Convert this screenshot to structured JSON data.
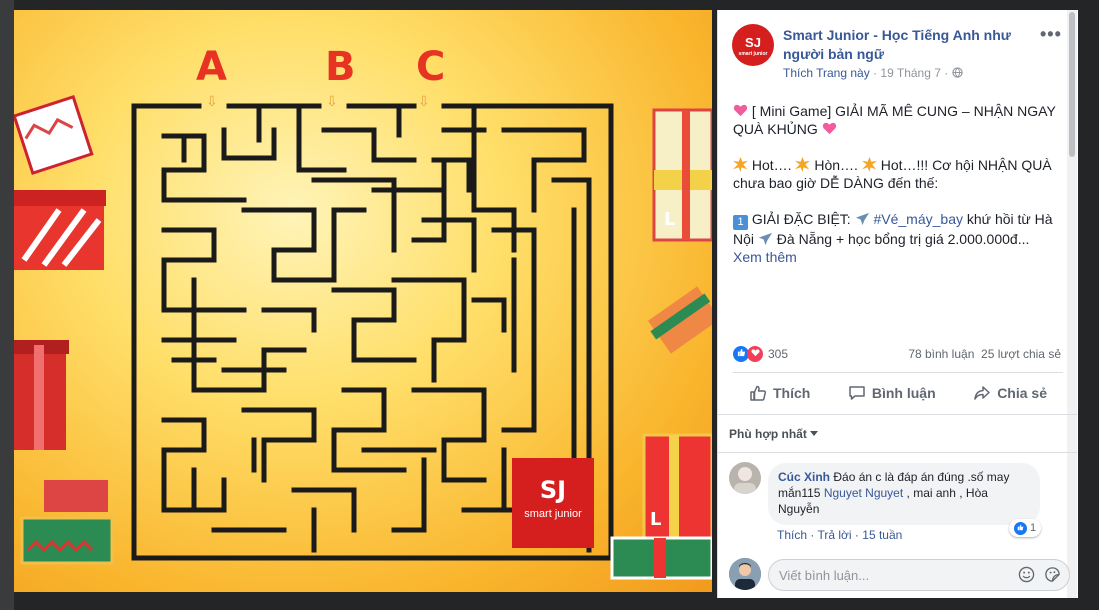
{
  "photo": {
    "maze_letters": [
      "A",
      "B",
      "C"
    ],
    "arrow_glyph": "⇩",
    "logo_mark": "SJ",
    "logo_text": "smart junior",
    "gift_label": "L"
  },
  "post": {
    "page_name": "Smart Junior - Học Tiếng Anh như người bản ngữ",
    "like_page": "Thích Trang này",
    "separator": "·",
    "date": "19 Tháng 7",
    "more": "•••",
    "paragraph1": "[ Mini Game] GIẢI MÃ MÊ CUNG – NHẬN NGAY QUÀ KHỦNG",
    "paragraph2_a": "Hot…. ",
    "paragraph2_b": "Hòn…. ",
    "paragraph2_c": "Hot…!!! Cơ hội NHẬN QUÀ chưa bao giờ DỄ DÀNG đến thế:",
    "paragraph3_num": "1",
    "paragraph3_a": "GIẢI ĐẶC BIỆT: ",
    "paragraph3_tag": "#Vé_máy_bay",
    "paragraph3_b": " khứ hồi từ Hà Nội ",
    "paragraph3_c": " Đà Nẵng + học bổng trị giá 2.000.000đ...",
    "see_more": "Xem thêm",
    "reaction_count": "305",
    "comments_count": "78 bình luận",
    "shares_count": "25 lượt chia sẻ",
    "action_like": "Thích",
    "action_comment": "Bình luận",
    "action_share": "Chia sẻ"
  },
  "comments": {
    "sort_label": "Phù hợp nhất",
    "items": [
      {
        "author": "Cúc Xinh",
        "text_a": "Đáo án c là đáp án đúng .số may mắn115 ",
        "tag1": "Nguyet Nguyet",
        "text_b": " , mai anh , Hòa Nguyễn",
        "like_count": "1",
        "like_label": "Thích",
        "reply_label": "Trả lời",
        "separator": "·",
        "age": "15 tuần"
      }
    ],
    "input_placeholder": "Viết bình luận..."
  },
  "colors": {
    "brand_red": "#d51f1e",
    "link_blue": "#385898",
    "like_blue": "#1877f2",
    "love_red": "#f33e58"
  },
  "icons": [
    "more-icon",
    "globe-icon",
    "heart-sparkle-icon",
    "explosion-icon",
    "keycap-one-icon",
    "airplane-icon",
    "like-reaction-icon",
    "love-reaction-icon",
    "thumbs-up-icon",
    "comment-icon",
    "share-icon",
    "chevron-down-icon",
    "emoji-icon",
    "sticker-icon"
  ]
}
